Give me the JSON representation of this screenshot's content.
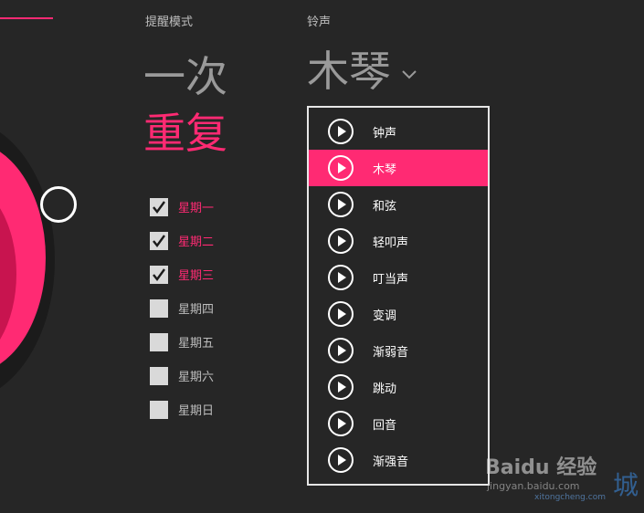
{
  "colors": {
    "accent": "#ff2a73",
    "background": "#262626",
    "muted_text": "#9a9a9a"
  },
  "alarm_mode": {
    "label": "提醒模式",
    "options": [
      "一次",
      "重复"
    ],
    "selected": "重复"
  },
  "ringtone": {
    "label": "铃声",
    "current": "木琴",
    "dropdown_icon": "chevron-down-icon",
    "options": [
      {
        "label": "钟声",
        "selected": false
      },
      {
        "label": "木琴",
        "selected": true
      },
      {
        "label": "和弦",
        "selected": false
      },
      {
        "label": "轻叩声",
        "selected": false
      },
      {
        "label": "叮当声",
        "selected": false
      },
      {
        "label": "变调",
        "selected": false
      },
      {
        "label": "渐弱音",
        "selected": false
      },
      {
        "label": "跳动",
        "selected": false
      },
      {
        "label": "回音",
        "selected": false
      },
      {
        "label": "渐强音",
        "selected": false
      }
    ],
    "item_icon": "play-icon"
  },
  "days": [
    {
      "label": "星期一",
      "checked": true
    },
    {
      "label": "星期二",
      "checked": true
    },
    {
      "label": "星期三",
      "checked": true
    },
    {
      "label": "星期四",
      "checked": false
    },
    {
      "label": "星期五",
      "checked": false
    },
    {
      "label": "星期六",
      "checked": false
    },
    {
      "label": "星期日",
      "checked": false
    }
  ],
  "watermark": {
    "brand": "Baidu 经验",
    "url": "jingyan.baidu.com",
    "site": "xitongcheng.com",
    "city_char": "城"
  }
}
